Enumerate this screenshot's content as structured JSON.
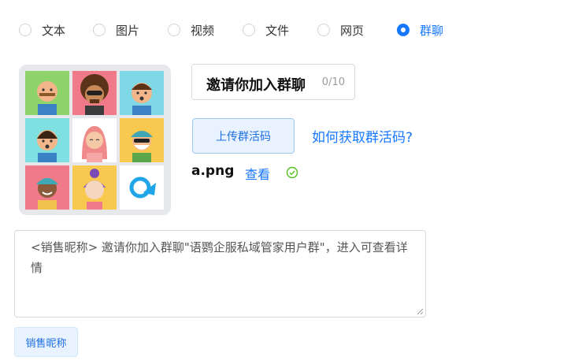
{
  "tabs": [
    {
      "label": "文本",
      "selected": false
    },
    {
      "label": "图片",
      "selected": false
    },
    {
      "label": "视频",
      "selected": false
    },
    {
      "label": "文件",
      "selected": false
    },
    {
      "label": "网页",
      "selected": false
    },
    {
      "label": "群聊",
      "selected": true
    }
  ],
  "group_image": {
    "avatars": [
      {
        "icon": "avatar-bald-man-icon",
        "bg": "#8fd36b"
      },
      {
        "icon": "avatar-curly-hair-sunglasses-icon",
        "bg": "#f07a8a"
      },
      {
        "icon": "avatar-boy-surprised-icon",
        "bg": "#7fd8e6"
      },
      {
        "icon": "avatar-girl-surprised-icon",
        "bg": "#7ee0e0"
      },
      {
        "icon": "avatar-pink-hair-girl-icon",
        "bg": "#ffffff"
      },
      {
        "icon": "avatar-old-man-cap-icon",
        "bg": "#f9c84f"
      },
      {
        "icon": "avatar-man-cap-smile-icon",
        "bg": "#f07a8a"
      },
      {
        "icon": "avatar-girl-bun-icon",
        "bg": "#f9c84f"
      },
      {
        "icon": "brand-logo-icon",
        "bg": "#ffffff"
      }
    ]
  },
  "group_name": {
    "value": "邀请你加入群聊",
    "counter": "0/10"
  },
  "upload": {
    "label": "上传群活码"
  },
  "help": {
    "label": "如何获取群活码?"
  },
  "file": {
    "name": "a.png",
    "view_label": "查看",
    "status_icon": "check-circle-icon",
    "status_color": "#52c41a"
  },
  "message": {
    "text": "<销售昵称> 邀请你加入群聊\"语鹦企服私域管家用户群\"，进入可查看详情"
  },
  "insert_tag": {
    "label": "销售昵称"
  },
  "colors": {
    "accent": "#1677ff"
  }
}
